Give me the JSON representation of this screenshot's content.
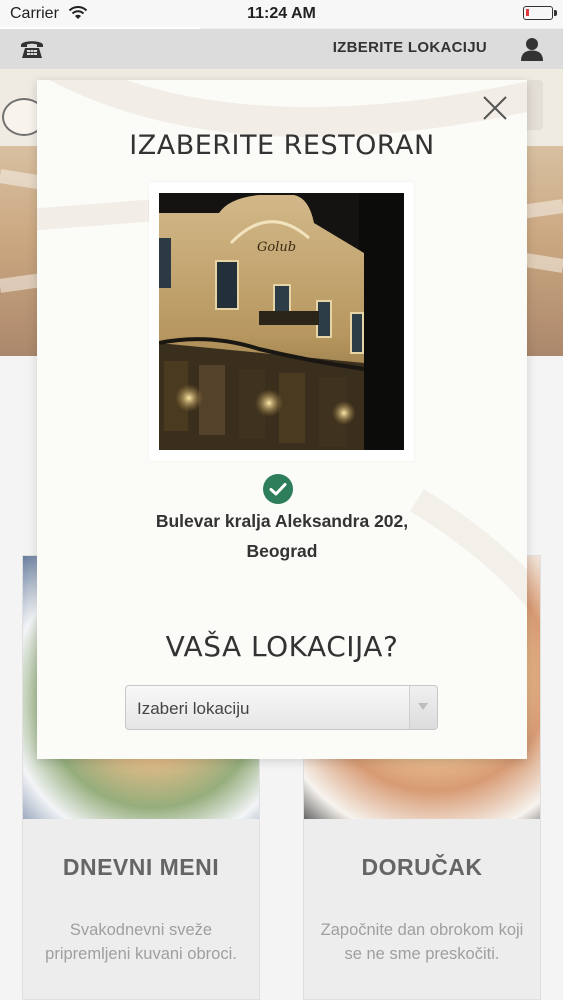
{
  "status_bar": {
    "carrier": "Carrier",
    "time": "11:24 AM"
  },
  "top_nav": {
    "title": "IZBERITE LOKACIJU",
    "left_icon": "phone-icon",
    "right_icon": "user-icon"
  },
  "background": {
    "cards": [
      {
        "title": "DNEVNI MENI",
        "description": "Svakodnevni sveže pripremljeni kuvani obroci."
      },
      {
        "title": "DORUČAK",
        "description": "Započnite dan obrokom koji se ne sme preskočiti."
      }
    ]
  },
  "modal": {
    "title": "IZABERITE RESTORAN",
    "close_icon": "close-icon",
    "photo_sign": "Golub",
    "address": "Bulevar kralja Aleksandra 202, Beograd",
    "selected_icon": "check-circle-icon",
    "location_question": "VAŠA LOKACIJA?",
    "select": {
      "value": "Izaberi lokaciju"
    }
  },
  "colors": {
    "accent_green": "#2e7d5b",
    "modal_bg": "#fbfbf8",
    "nav_bg": "#dcdcdc",
    "battery_low": "#e23b3b"
  }
}
